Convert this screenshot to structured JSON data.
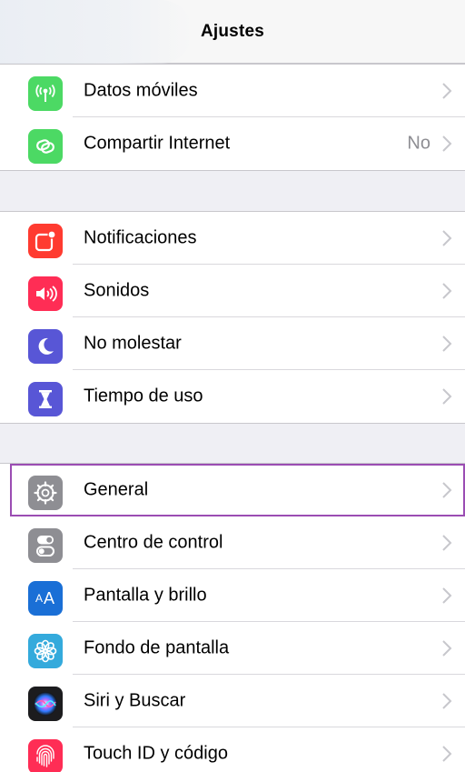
{
  "header": {
    "title": "Ajustes"
  },
  "group1": [
    {
      "label": "Datos móviles",
      "detail": "",
      "icon": "antenna-icon",
      "color": "#4cd964"
    },
    {
      "label": "Compartir Internet",
      "detail": "No",
      "icon": "chain-link-icon",
      "color": "#4cd964"
    }
  ],
  "group2": [
    {
      "label": "Notificaciones",
      "detail": "",
      "icon": "notifications-icon",
      "color": "#ff3b30"
    },
    {
      "label": "Sonidos",
      "detail": "",
      "icon": "speaker-icon",
      "color": "#ff2d55"
    },
    {
      "label": "No molestar",
      "detail": "",
      "icon": "moon-icon",
      "color": "#5856d6"
    },
    {
      "label": "Tiempo de uso",
      "detail": "",
      "icon": "hourglass-icon",
      "color": "#5856d6"
    }
  ],
  "group3": [
    {
      "label": "General",
      "detail": "",
      "icon": "gear-icon",
      "color": "#8e8e93",
      "selected": true
    },
    {
      "label": "Centro de control",
      "detail": "",
      "icon": "toggles-icon",
      "color": "#8e8e93"
    },
    {
      "label": "Pantalla y brillo",
      "detail": "",
      "icon": "text-size-icon",
      "color": "#1a6fd6",
      "glyph": "AA"
    },
    {
      "label": "Fondo de pantalla",
      "detail": "",
      "icon": "flower-icon",
      "color": "#34aadc"
    },
    {
      "label": "Siri y Buscar",
      "detail": "",
      "icon": "siri-icon",
      "color": "#1c1c1e"
    },
    {
      "label": "Touch ID y código",
      "detail": "",
      "icon": "fingerprint-icon",
      "color": "#ff2d55"
    }
  ],
  "colors": {
    "selection_border": "#9b4db3",
    "chevron": "#c7c7cc"
  }
}
